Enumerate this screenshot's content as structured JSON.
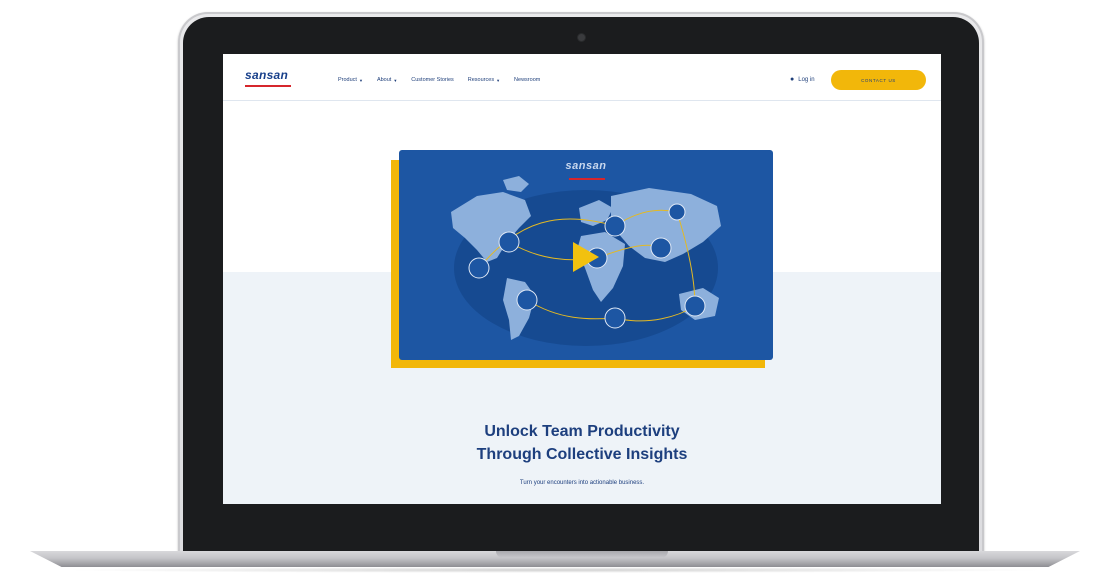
{
  "header": {
    "logo": "sansan",
    "nav": [
      {
        "label": "Product",
        "dropdown": true
      },
      {
        "label": "About",
        "dropdown": true
      },
      {
        "label": "Customer Stories",
        "dropdown": false
      },
      {
        "label": "Resources",
        "dropdown": true
      },
      {
        "label": "Newsroom",
        "dropdown": false
      }
    ],
    "login_label": "Log in",
    "cta_label": "CONTACT US"
  },
  "video": {
    "brand": "sansan",
    "play_icon": "play-icon"
  },
  "hero": {
    "title_line1": "Unlock Team Productivity",
    "title_line2": "Through Collective Insights",
    "subtitle": "Turn your encounters into actionable business."
  },
  "colors": {
    "brand_blue": "#1d56a3",
    "navy": "#1d3f7e",
    "accent_yellow": "#f2b70a",
    "brand_red": "#d6262c"
  }
}
